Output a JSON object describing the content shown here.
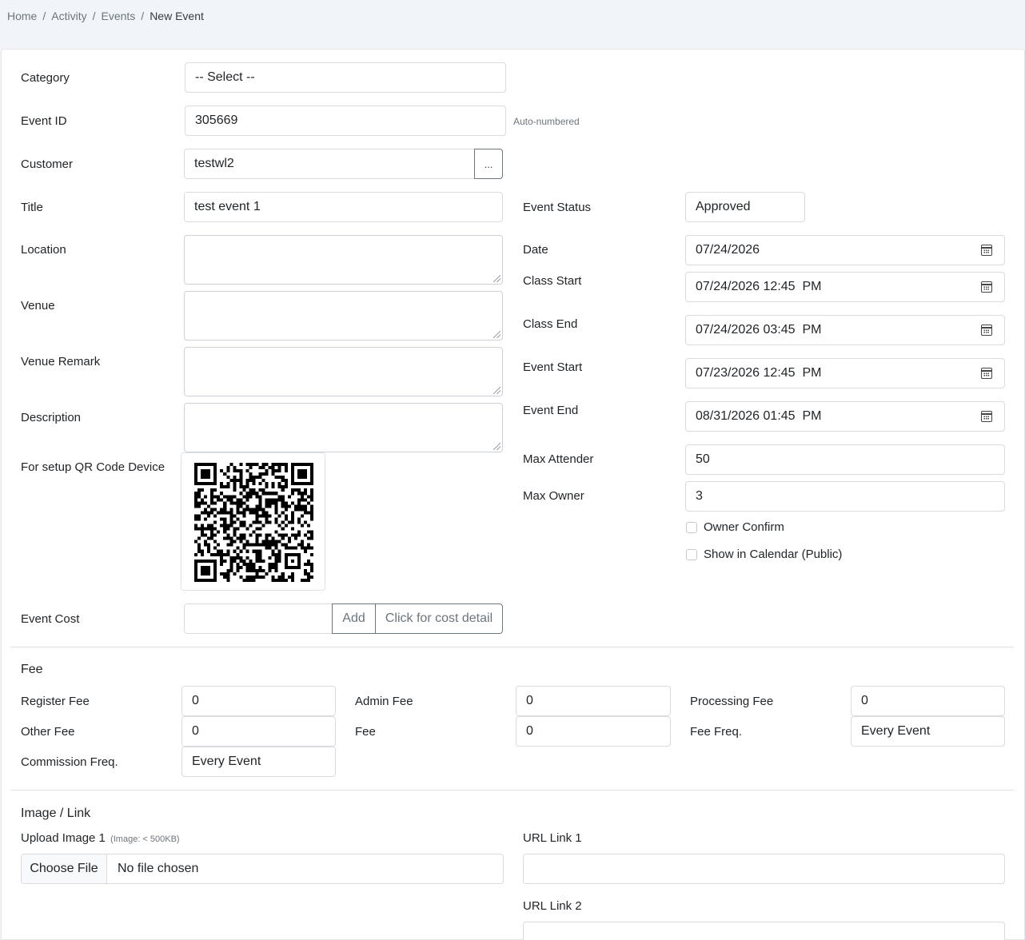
{
  "breadcrumb": {
    "home": "Home",
    "activity": "Activity",
    "events": "Events",
    "current": "New Event"
  },
  "form": {
    "category": {
      "label": "Category",
      "value": "-- Select --"
    },
    "event_id": {
      "label": "Event ID",
      "value": "305669",
      "hint": "Auto-numbered"
    },
    "customer": {
      "label": "Customer",
      "value": "testwl2",
      "button": "..."
    },
    "title": {
      "label": "Title",
      "value": "test event 1"
    },
    "location": {
      "label": "Location",
      "value": ""
    },
    "venue": {
      "label": "Venue",
      "value": ""
    },
    "venue_remark": {
      "label": "Venue Remark",
      "value": ""
    },
    "description": {
      "label": "Description",
      "value": ""
    },
    "qr": {
      "label": "For setup QR Code Device",
      "icon": "qr-code-icon"
    },
    "event_cost": {
      "label": "Event Cost",
      "value": "",
      "add_label": "Add",
      "detail_label": "Click for cost detail"
    },
    "event_status": {
      "label": "Event Status",
      "value": "Approved"
    },
    "date": {
      "label": "Date",
      "value": "07/24/2026"
    },
    "class_start": {
      "label": "Class Start",
      "value": "07/24/2026 12:45  PM"
    },
    "class_end": {
      "label": "Class End",
      "value": "07/24/2026 03:45  PM"
    },
    "event_start": {
      "label": "Event Start",
      "value": "07/23/2026 12:45  PM"
    },
    "event_end": {
      "label": "Event End",
      "value": "08/31/2026 01:45  PM"
    },
    "max_attender": {
      "label": "Max Attender",
      "value": "50"
    },
    "max_owner": {
      "label": "Max Owner",
      "value": "3"
    },
    "owner_confirm": {
      "label": "Owner Confirm",
      "checked": false
    },
    "show_calendar": {
      "label": "Show in Calendar (Public)",
      "checked": false
    }
  },
  "fee": {
    "heading": "Fee",
    "register_fee": {
      "label": "Register Fee",
      "value": "0"
    },
    "admin_fee": {
      "label": "Admin Fee",
      "value": "0"
    },
    "processing_fee": {
      "label": "Processing Fee",
      "value": "0"
    },
    "other_fee": {
      "label": "Other Fee",
      "value": "0"
    },
    "fee": {
      "label": "Fee",
      "value": "0"
    },
    "fee_freq": {
      "label": "Fee Freq.",
      "value": "Every Event"
    },
    "commission_freq": {
      "label": "Commission Freq.",
      "value": "Every Event"
    }
  },
  "image_link": {
    "heading": "Image / Link",
    "upload_label": "Upload Image 1",
    "upload_hint": "(Image: < 500KB)",
    "choose_file": "Choose File",
    "no_file": "No file chosen",
    "url1": {
      "label": "URL Link 1",
      "value": ""
    },
    "url2": {
      "label": "URL Link 2",
      "value": ""
    }
  },
  "colors": {
    "page_bg": "#f1f4f8",
    "border": "#d8dce1",
    "muted": "#6c757d"
  }
}
